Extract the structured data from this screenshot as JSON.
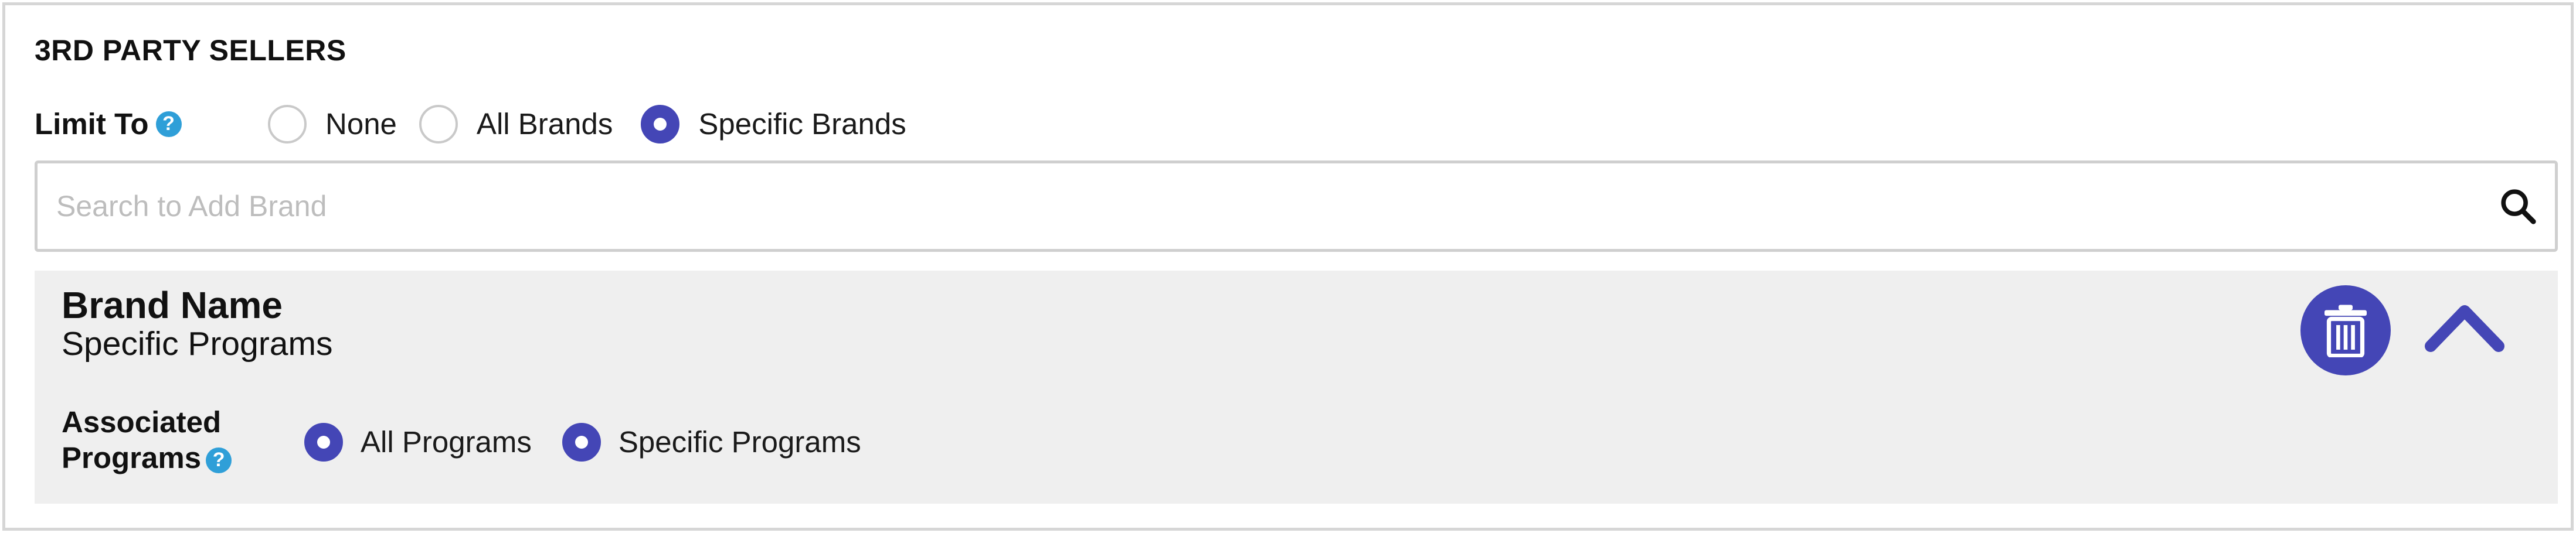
{
  "section": {
    "title": "3RD PARTY SELLERS"
  },
  "limit_to": {
    "label": "Limit To",
    "help_glyph": "?",
    "options": [
      {
        "label": "None",
        "checked": false
      },
      {
        "label": "All Brands",
        "checked": false
      },
      {
        "label": "Specific Brands",
        "checked": true
      }
    ]
  },
  "search": {
    "placeholder": "Search to Add Brand",
    "value": "",
    "icon": "search-icon"
  },
  "brand": {
    "name": "Brand Name",
    "subtitle": "Specific Programs",
    "delete_icon": "trash-icon",
    "collapse_icon": "chevron-up-icon",
    "associated_programs": {
      "label_line1": "Associated",
      "label_line2": "Programs",
      "help_glyph": "?",
      "options": [
        {
          "label": "All Programs",
          "checked": true
        },
        {
          "label": "Specific Programs",
          "checked": true
        }
      ]
    }
  },
  "colors": {
    "accent": "#4446b6",
    "help": "#2f9fd8",
    "card_bg": "#efefef",
    "border": "#d6d6d6"
  }
}
